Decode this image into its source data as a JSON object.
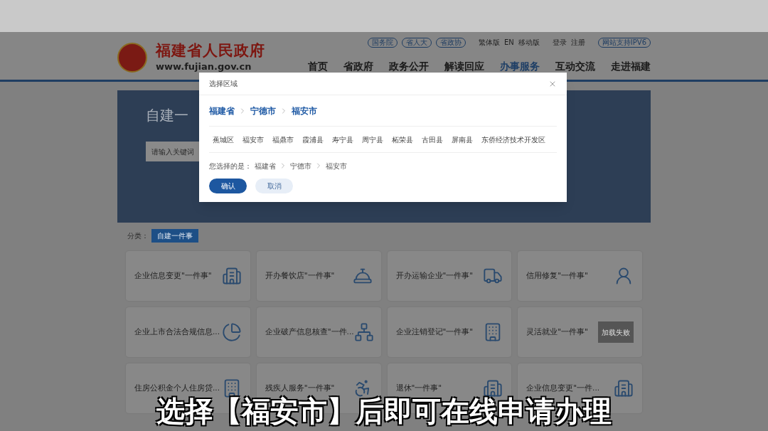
{
  "header": {
    "site_name": "福建省人民政府",
    "domain": "www.fujian.gov.cn",
    "top_links": [
      {
        "label": "国务院",
        "kind": "pill"
      },
      {
        "label": "省人大",
        "kind": "pill"
      },
      {
        "label": "省政协",
        "kind": "pill"
      },
      {
        "label": "繁体版",
        "kind": "link"
      },
      {
        "label": "EN",
        "kind": "link"
      },
      {
        "label": "移动版",
        "kind": "link"
      },
      {
        "label": "登录",
        "kind": "link"
      },
      {
        "label": "注册",
        "kind": "link"
      },
      {
        "label": "网站支持IPV6",
        "kind": "pill"
      }
    ],
    "nav": [
      {
        "label": "首页",
        "selected": false
      },
      {
        "label": "省政府",
        "selected": false
      },
      {
        "label": "政务公开",
        "selected": false
      },
      {
        "label": "解读回应",
        "selected": false
      },
      {
        "label": "办事服务",
        "selected": true
      },
      {
        "label": "互动交流",
        "selected": false
      },
      {
        "label": "走进福建",
        "selected": false
      }
    ]
  },
  "banner": {
    "title": "自建一",
    "search": {
      "placeholder": "请输入关键词"
    }
  },
  "category": {
    "label": "分类：",
    "tag": "自建一件事"
  },
  "cards": [
    {
      "label": "企业信息变更\"一件事\"",
      "kind": "icon"
    },
    {
      "label": "开办餐饮店\"一件事\"",
      "kind": "icon"
    },
    {
      "label": "开办运输企业\"一件事\"",
      "kind": "icon"
    },
    {
      "label": "信用修复\"一件事\"",
      "kind": "icon"
    },
    {
      "label": "企业上市合法合规信息...",
      "kind": "icon"
    },
    {
      "label": "企业破产信息核查\"一件...",
      "kind": "icon"
    },
    {
      "label": "企业注销登记\"一件事\"",
      "kind": "icon"
    },
    {
      "label": "灵活就业\"一件事\"",
      "kind": "failed_image",
      "image_text": "加载失败"
    },
    {
      "label": "住房公积金个人住房贷...",
      "kind": "icon"
    },
    {
      "label": "残疾人服务\"一件事\"",
      "kind": "icon"
    },
    {
      "label": "退休\"一件事\"",
      "kind": "icon"
    },
    {
      "label": "企业信息变更\"一件...",
      "kind": "icon"
    }
  ],
  "dialog": {
    "title": "选择区域",
    "path": [
      "福建省",
      "宁德市",
      "福安市"
    ],
    "districts": [
      "蕉城区",
      "福安市",
      "福鼎市",
      "霞浦县",
      "寿宁县",
      "周宁县",
      "柘荣县",
      "古田县",
      "屏南县",
      "东侨经济技术开发区"
    ],
    "selection_label": "您选择的是：",
    "selection": [
      "福建省",
      "宁德市",
      "福安市"
    ],
    "buttons": [
      {
        "label": "确认",
        "kind": "primary"
      },
      {
        "label": "取消",
        "kind": "secondary"
      }
    ]
  },
  "subtitle": "选择【福安市】后即可在线申请办理"
}
